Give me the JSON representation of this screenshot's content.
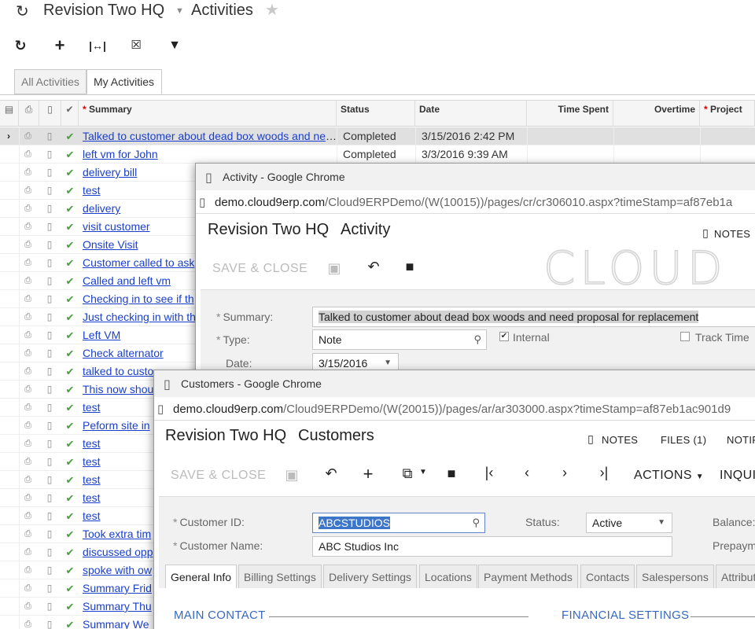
{
  "page": {
    "company": "Revision Two HQ",
    "screen": "Activities",
    "tabs": [
      "All Activities",
      "My Activities"
    ],
    "columns": {
      "summary": "Summary",
      "status": "Status",
      "date": "Date",
      "time_spent": "Time Spent",
      "overtime": "Overtime",
      "project": "Project"
    },
    "rows": [
      {
        "summary": "Talked to customer about dead box woods and need proposal for replacement",
        "status": "Completed",
        "date": "3/15/2016 2:42 PM"
      },
      {
        "summary": "left vm for John",
        "status": "Completed",
        "date": "3/3/2016 9:39 AM"
      },
      {
        "summary": "delivery bill",
        "status": "",
        "date": ""
      },
      {
        "summary": "test",
        "status": "",
        "date": ""
      },
      {
        "summary": "delivery",
        "status": "",
        "date": ""
      },
      {
        "summary": "visit customer",
        "status": "",
        "date": ""
      },
      {
        "summary": "Onsite Visit",
        "status": "",
        "date": ""
      },
      {
        "summary": "Customer called to ask",
        "status": "",
        "date": ""
      },
      {
        "summary": "Called and left vm",
        "status": "",
        "date": ""
      },
      {
        "summary": "Checking in to see if th",
        "status": "",
        "date": ""
      },
      {
        "summary": "Just checking in with th",
        "status": "",
        "date": ""
      },
      {
        "summary": "Left VM",
        "status": "",
        "date": ""
      },
      {
        "summary": "Check alternator",
        "status": "",
        "date": ""
      },
      {
        "summary": "talked to custo",
        "status": "",
        "date": ""
      },
      {
        "summary": "This now shou",
        "status": "",
        "date": ""
      },
      {
        "summary": "test",
        "status": "",
        "date": ""
      },
      {
        "summary": "Peform site in",
        "status": "",
        "date": ""
      },
      {
        "summary": "test",
        "status": "",
        "date": ""
      },
      {
        "summary": "test",
        "status": "",
        "date": ""
      },
      {
        "summary": "test",
        "status": "",
        "date": ""
      },
      {
        "summary": "test",
        "status": "",
        "date": ""
      },
      {
        "summary": "test",
        "status": "",
        "date": ""
      },
      {
        "summary": "Took extra tim",
        "status": "",
        "date": ""
      },
      {
        "summary": "discussed opp",
        "status": "",
        "date": ""
      },
      {
        "summary": "spoke with ow",
        "status": "",
        "date": ""
      },
      {
        "summary": "Summary Frid",
        "status": "",
        "date": ""
      },
      {
        "summary": "Summary Thu",
        "status": "",
        "date": ""
      },
      {
        "summary": "Summary We",
        "status": "",
        "date": ""
      }
    ]
  },
  "activity_window": {
    "title": "Activity - Google Chrome",
    "url_domain": "demo.cloud9erp.com",
    "url_path": "/Cloud9ERPDemo/(W(10015))/pages/cr/cr306010.aspx?timeStamp=af87eb1a",
    "company": "Revision Two HQ",
    "screen": "Activity",
    "notes": "NOTES",
    "save_close": "SAVE & CLOSE",
    "logo_text": "CLOUD",
    "summary_label": "Summary:",
    "summary_value": "Talked to customer about dead box woods and need proposal for replacement",
    "type_label": "Type:",
    "type_value": "Note",
    "internal_label": "Internal",
    "track_time_label": "Track Time",
    "date_label": "Date:",
    "date_value": "3/15/2016"
  },
  "customers_window": {
    "title": "Customers - Google Chrome",
    "url_domain": "demo.cloud9erp.com",
    "url_path": "/Cloud9ERPDemo/(W(20015))/pages/ar/ar303000.aspx?timeStamp=af87eb1ac901d9",
    "company": "Revision Two HQ",
    "screen": "Customers",
    "notes": "NOTES",
    "files": "FILES (1)",
    "notif": "NOTIF",
    "save_close": "SAVE & CLOSE",
    "actions": "ACTIONS",
    "inquiries": "INQUI",
    "customer_id_label": "Customer ID:",
    "customer_id_value": "ABCSTUDIOS",
    "status_label": "Status:",
    "status_value": "Active",
    "balance_label": "Balance:",
    "customer_name_label": "Customer Name:",
    "customer_name_value": "ABC Studios Inc",
    "prepayments_label": "Prepaym",
    "tabs": [
      "General Info",
      "Billing Settings",
      "Delivery Settings",
      "Locations",
      "Payment Methods",
      "Contacts",
      "Salespersons",
      "Attribut"
    ],
    "main_contact": "MAIN CONTACT",
    "financial_settings": "FINANCIAL SETTINGS"
  },
  "colors": {
    "link": "#1a3fcc",
    "check_green": "#4a9c3f",
    "section_blue": "#3869c0",
    "selection_blue": "#3d76c8"
  }
}
